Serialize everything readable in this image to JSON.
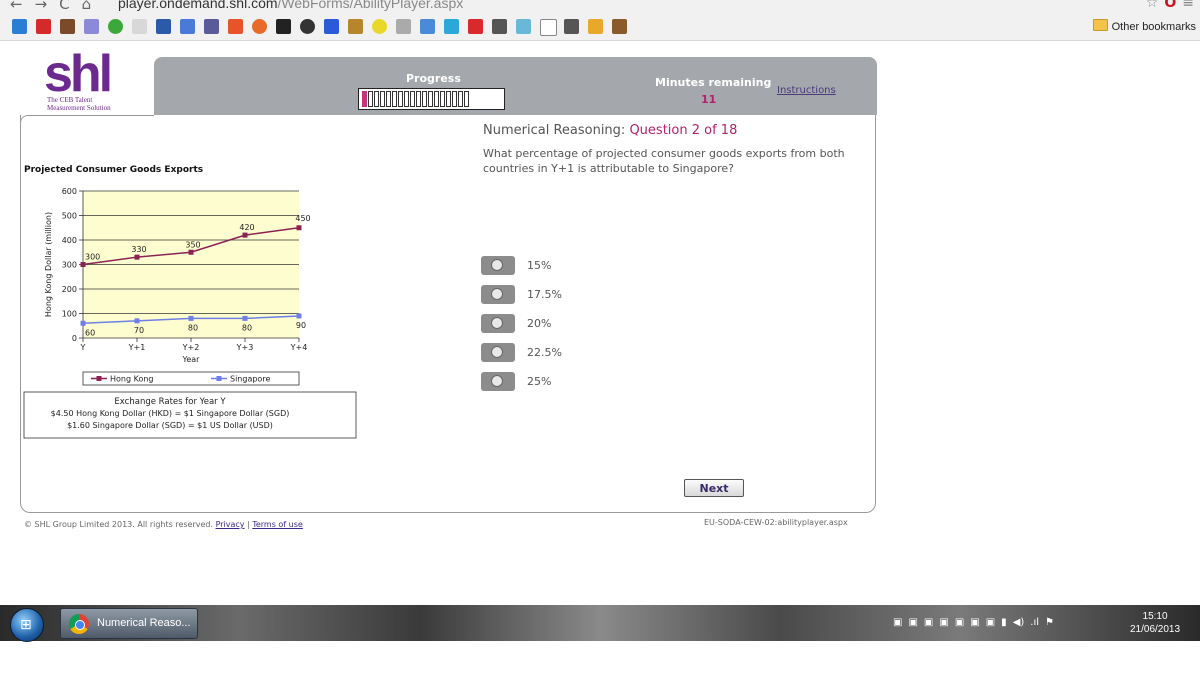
{
  "browser": {
    "url_domain": "player.ondemand.shl.com",
    "url_path": "/WebForms/AbilityPlayer.aspx",
    "other_bookmarks": "Other bookmarks"
  },
  "header": {
    "logo_text": "shl",
    "logo_tagline": "The CEB Talent Measurement Solution",
    "progress_label": "Progress",
    "progress_segments_total": 18,
    "progress_segments_done": 1,
    "minutes_label": "Minutes remaining",
    "minutes_value": "11",
    "instructions_link": "Instructions"
  },
  "question": {
    "prefix": "Numerical Reasoning:",
    "number": "Question 2 of 18",
    "text": "What percentage of projected consumer goods exports from both countries in Y+1 is attributable to Singapore?",
    "answers": [
      "15%",
      "17.5%",
      "20%",
      "22.5%",
      "25%"
    ],
    "next_label": "Next"
  },
  "chart_data": {
    "type": "line",
    "title": "Projected Consumer Goods Exports",
    "xlabel": "Year",
    "ylabel": "Hong Kong Dollar (million)",
    "categories": [
      "Y",
      "Y+1",
      "Y+2",
      "Y+3",
      "Y+4"
    ],
    "ylim": [
      0,
      600
    ],
    "yticks": [
      0,
      100,
      200,
      300,
      400,
      500,
      600
    ],
    "grid": true,
    "legend_position": "bottom",
    "series": [
      {
        "name": "Hong Kong",
        "values": [
          300,
          330,
          350,
          420,
          450
        ],
        "color": "#8b2252"
      },
      {
        "name": "Singapore",
        "values": [
          60,
          70,
          80,
          80,
          90
        ],
        "color": "#6f7fe8"
      }
    ],
    "note_title": "Exchange Rates for Year Y",
    "note_lines": [
      "$4.50 Hong Kong Dollar (HKD) = $1 Singapore Dollar (SGD)",
      "$1.60 Singapore Dollar (SGD) = $1 US Dollar (USD)"
    ]
  },
  "footer": {
    "copyright": "© SHL Group Limited 2013. All rights reserved.",
    "privacy": "Privacy",
    "separator": "|",
    "terms": "Terms of use",
    "page_id": "EU-SODA-CEW-02:abilityplayer.aspx"
  },
  "taskbar": {
    "task_label": "Numerical Reaso...",
    "time": "15:10",
    "date": "21/06/2013"
  }
}
